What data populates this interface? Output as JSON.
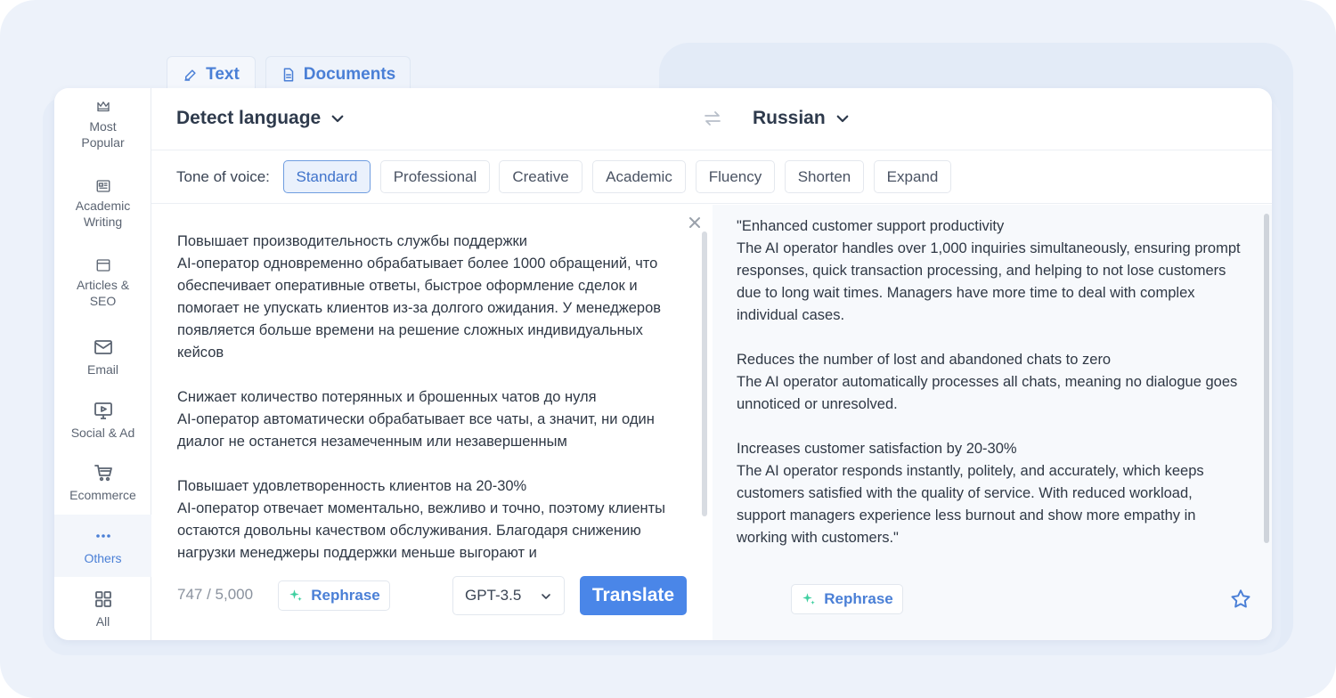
{
  "tabs": [
    {
      "label": "Text",
      "icon": "pencil-icon",
      "active": true
    },
    {
      "label": "Documents",
      "icon": "document-icon",
      "active": false
    }
  ],
  "sidebar": {
    "items": [
      {
        "label": "Most\nPopular",
        "icon": "crown-icon"
      },
      {
        "label": "Academic\nWriting",
        "icon": "newspaper-icon"
      },
      {
        "label": "Articles &\nSEO",
        "icon": "browser-window-icon"
      },
      {
        "label": "Email",
        "icon": "mail-icon"
      },
      {
        "label": "Social & Ad",
        "icon": "monitor-play-icon"
      },
      {
        "label": "Ecommerce",
        "icon": "cart-icon"
      },
      {
        "label": "Others",
        "icon": "more-dots-icon",
        "active": true
      },
      {
        "label": "All",
        "icon": "grid-icon"
      }
    ]
  },
  "languages": {
    "source": "Detect language",
    "target": "Russian"
  },
  "tone": {
    "label": "Tone of voice:",
    "options": [
      "Standard",
      "Professional",
      "Creative",
      "Academic",
      "Fluency",
      "Shorten",
      "Expand"
    ],
    "selected": "Standard"
  },
  "source_panel": {
    "text": "Повышает производительность службы поддержки\nAI-оператор одновременно обрабатывает более 1000 обращений, что обеспечивает оперативные ответы, быстрое оформление сделок и помогает не упускать клиентов из-за долгого ожидания. У менеджеров появляется больше времени на решение сложных индивидуальных кейсов\n\nСнижает количество потерянных и брошенных чатов до нуля\nAI-оператор автоматически обрабатывает все чаты, а значит, ни один диалог не останется незамеченным или незавершенным\n\nПовышает удовлетворенность клиентов на 20-30%\nAI-оператор отвечает моментально, вежливо и точно, поэтому клиенты остаются довольны качеством обслуживания. Благодаря снижению нагрузки менеджеры поддержки меньше выгорают и",
    "counter": "747 / 5,000",
    "rephrase_label": "Rephrase",
    "model": "GPT-3.5",
    "translate_label": "Translate"
  },
  "target_panel": {
    "text": "\"Enhanced customer support productivity\nThe AI operator handles over 1,000 inquiries simultaneously, ensuring prompt responses, quick transaction processing, and helping to not lose customers due to long wait times. Managers have more time to deal with complex individual cases.\n\nReduces the number of lost and abandoned chats to zero\nThe AI operator automatically processes all chats, meaning no dialogue goes unnoticed or unresolved.\n\nIncreases customer satisfaction by 20-30%\nThe AI operator responds instantly, politely, and accurately, which keeps customers satisfied with the quality of service. With reduced workload, support managers experience less burnout and show more empathy in working with customers.\"",
    "rephrase_label": "Rephrase"
  },
  "colors": {
    "accent": "#4a86e8",
    "accent_text": "#4a7fd6",
    "sparkle": "#3ecfa0"
  }
}
